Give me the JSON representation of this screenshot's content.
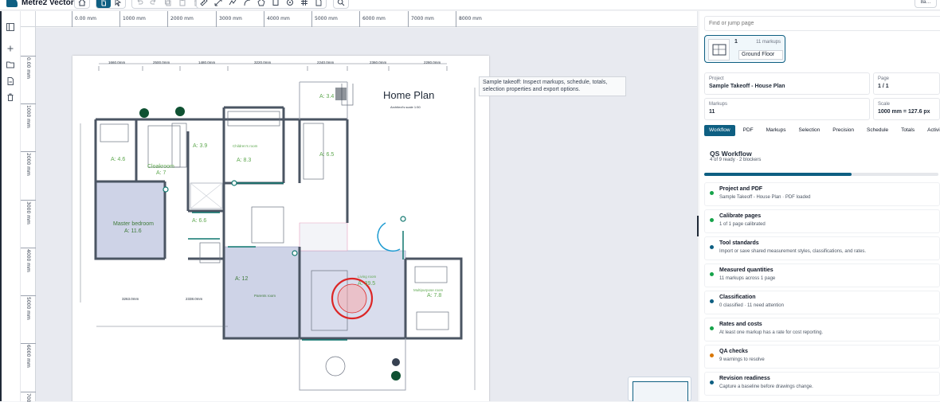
{
  "app": {
    "name": "Metre2 Vector",
    "corner_button": "8a…"
  },
  "toolbar": {
    "group1": [
      "home-icon"
    ],
    "group2": [
      "hand-icon",
      "pointer-icon"
    ],
    "group3": [
      "undo-icon",
      "redo-icon",
      "copy-icon",
      "paste-icon",
      "delete-icon"
    ],
    "group4": [
      "ruler-icon",
      "measure-icon",
      "polyline-icon",
      "arc-icon",
      "polygon-icon",
      "rect-icon",
      "count-icon",
      "grid-icon",
      "page-icon"
    ],
    "group5": [
      "search-icon"
    ]
  },
  "rail": [
    "panel-toggle-icon",
    "plus-icon",
    "folder-icon",
    "export-icon",
    "trash-icon"
  ],
  "ruler": {
    "h_labels": [
      "0.00 mm",
      "1000 mm",
      "2000 mm",
      "3000 mm",
      "4000 mm",
      "5000 mm",
      "6000 mm",
      "7000 mm",
      "8000 mm"
    ],
    "v_labels": [
      "0.00 mm",
      "1000 mm",
      "2000 mm",
      "3000 mm",
      "4000 mm",
      "5000 mm",
      "6000 mm",
      "700"
    ]
  },
  "drawing": {
    "title": "Home Plan",
    "subtitle": "Architect's scale 1:50",
    "dims_top": [
      "1660.0mm",
      "2500.0mm",
      "1480.0mm",
      "3220.0mm",
      "2240.0mm",
      "2360.0mm",
      "2280.0mm"
    ],
    "dims_bottom": [
      "3263.0mm",
      "2338.0mm"
    ],
    "rooms": [
      {
        "area": "A: 4.6",
        "name": ""
      },
      {
        "area": "A: 7",
        "name": "Cloakroom"
      },
      {
        "area": "A: 3.9",
        "name": ""
      },
      {
        "area": "A: 8.3",
        "name": "Children's room"
      },
      {
        "area": "A: 3.4",
        "name": ""
      },
      {
        "area": "A: 6.5",
        "name": ""
      },
      {
        "area": "A: 11.6",
        "name": "Master bedroom"
      },
      {
        "area": "A: 6.6",
        "name": ""
      },
      {
        "area": "A: 12",
        "name": "Parents room"
      },
      {
        "area": "A: 39.5",
        "name": "Living room"
      },
      {
        "area": "A: 7.8",
        "name": "Multipurpose room"
      }
    ]
  },
  "tooltip": "Sample takeoff: Inspect markups, schedule, totals, selection properties and export options.",
  "panel": {
    "search_placeholder": "Find or jump page",
    "page_card": {
      "number": "1",
      "markups": "11 markups",
      "name": "Ground Floor"
    },
    "project": {
      "label": "Project",
      "value": "Sample Takeoff  -  House Plan"
    },
    "page": {
      "label": "Page",
      "value": "1 / 1"
    },
    "markups": {
      "label": "Markups",
      "value": "11"
    },
    "scale": {
      "label": "Scale",
      "value": "1000 mm = 127.6 px"
    },
    "tabs": [
      "Workflow",
      "PDF",
      "Markups",
      "Selection",
      "Precision",
      "Schedule",
      "Totals",
      "Activi"
    ],
    "active_tab": "Workflow",
    "workflow": {
      "title": "QS Workflow",
      "summary": "4 of 9 ready · 2 blockers",
      "progress": 0.63,
      "steps": [
        {
          "title": "Project and PDF",
          "desc": "Sample Takeoff  -  House Plan · PDF loaded",
          "status": "#16a34a"
        },
        {
          "title": "Calibrate pages",
          "desc": "1 of 1 page calibrated",
          "status": "#16a34a"
        },
        {
          "title": "Tool standards",
          "desc": "Import or save shared measurement styles, classifications, and rates.",
          "status": "#0e5f82"
        },
        {
          "title": "Measured quantities",
          "desc": "11 markups across 1 page",
          "status": "#16a34a"
        },
        {
          "title": "Classification",
          "desc": "0 classified · 11 need attention",
          "status": "#0e5f82"
        },
        {
          "title": "Rates and costs",
          "desc": "At least one markup has a rate for cost reporting.",
          "status": "#16a34a"
        },
        {
          "title": "QA checks",
          "desc": "9 warnings to resolve",
          "status": "#d97706"
        },
        {
          "title": "Revision readiness",
          "desc": "Capture a baseline before drawings change.",
          "status": "#0e5f82"
        }
      ]
    }
  },
  "colors": {
    "accent": "#0e5f82",
    "room_fill": "#c5cbe3",
    "area_text": "#5fa850"
  }
}
